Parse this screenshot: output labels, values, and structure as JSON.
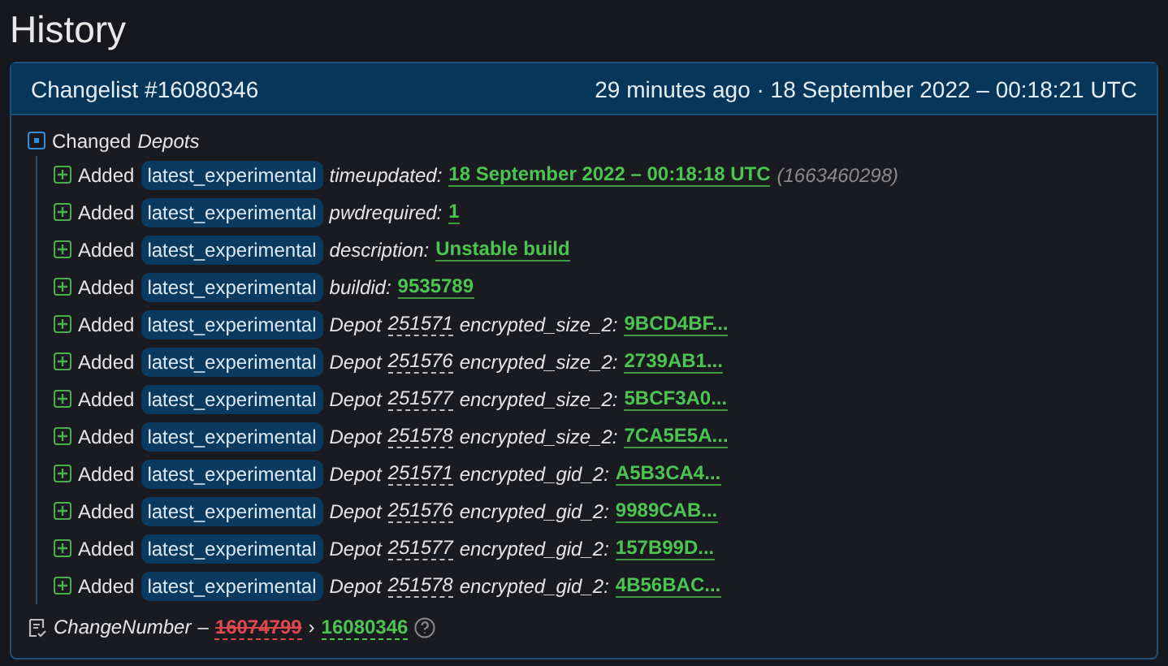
{
  "page_title": "History",
  "changelist": {
    "title": "Changelist #16080346",
    "time": "29 minutes ago · 18 September 2022 – 00:18:21 UTC",
    "group": {
      "verb": "Changed",
      "target": "Depots",
      "expanded": true,
      "rows": [
        {
          "kind": "key",
          "action": "Added",
          "branch": "latest_experimental",
          "key": "timeupdated:",
          "value": "18 September 2022 – 00:18:18 UTC",
          "note": "(1663460298)"
        },
        {
          "kind": "key",
          "action": "Added",
          "branch": "latest_experimental",
          "key": "pwdrequired:",
          "value": "1"
        },
        {
          "kind": "key",
          "action": "Added",
          "branch": "latest_experimental",
          "key": "description:",
          "value": "Unstable build"
        },
        {
          "kind": "key",
          "action": "Added",
          "branch": "latest_experimental",
          "key": "buildid:",
          "value": "9535789"
        },
        {
          "kind": "depot",
          "action": "Added",
          "branch": "latest_experimental",
          "depot_label": "Depot",
          "depot_id": "251571",
          "key": "encrypted_size_2:",
          "value": "9BCD4BF..."
        },
        {
          "kind": "depot",
          "action": "Added",
          "branch": "latest_experimental",
          "depot_label": "Depot",
          "depot_id": "251576",
          "key": "encrypted_size_2:",
          "value": "2739AB1..."
        },
        {
          "kind": "depot",
          "action": "Added",
          "branch": "latest_experimental",
          "depot_label": "Depot",
          "depot_id": "251577",
          "key": "encrypted_size_2:",
          "value": "5BCF3A0..."
        },
        {
          "kind": "depot",
          "action": "Added",
          "branch": "latest_experimental",
          "depot_label": "Depot",
          "depot_id": "251578",
          "key": "encrypted_size_2:",
          "value": "7CA5E5A..."
        },
        {
          "kind": "depot",
          "action": "Added",
          "branch": "latest_experimental",
          "depot_label": "Depot",
          "depot_id": "251571",
          "key": "encrypted_gid_2:",
          "value": "A5B3CA4..."
        },
        {
          "kind": "depot",
          "action": "Added",
          "branch": "latest_experimental",
          "depot_label": "Depot",
          "depot_id": "251576",
          "key": "encrypted_gid_2:",
          "value": "9989CAB..."
        },
        {
          "kind": "depot",
          "action": "Added",
          "branch": "latest_experimental",
          "depot_label": "Depot",
          "depot_id": "251577",
          "key": "encrypted_gid_2:",
          "value": "157B99D..."
        },
        {
          "kind": "depot",
          "action": "Added",
          "branch": "latest_experimental",
          "depot_label": "Depot",
          "depot_id": "251578",
          "key": "encrypted_gid_2:",
          "value": "4B56BAC..."
        }
      ]
    },
    "footer": {
      "key": "ChangeNumber",
      "dash": "–",
      "old": "16074799",
      "arrow": "›",
      "new": "16080346"
    }
  }
}
